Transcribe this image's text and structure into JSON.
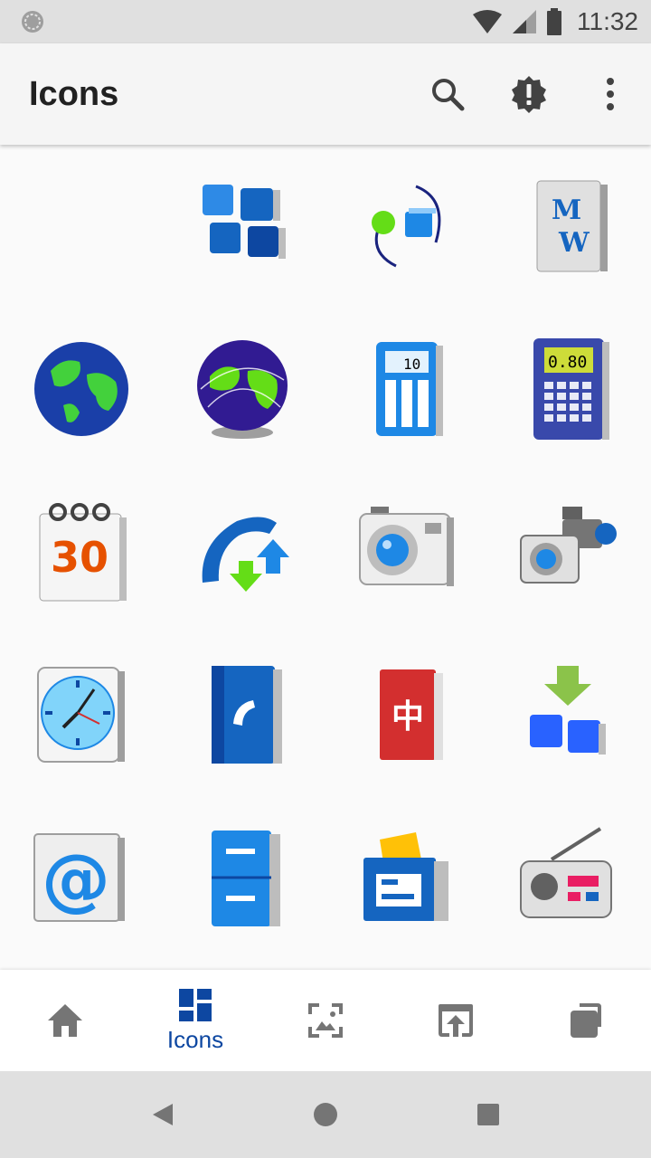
{
  "status_bar": {
    "time": "11:32"
  },
  "app_bar": {
    "title": "Icons"
  },
  "icons": [
    {
      "name": "windows-tiles-icon"
    },
    {
      "name": "network-connection-icon"
    },
    {
      "name": "mediawiki-icon"
    },
    {
      "name": "globe-icon"
    },
    {
      "name": "network-globe-icon"
    },
    {
      "name": "calculator-icon",
      "text": "10"
    },
    {
      "name": "scientific-calculator-icon",
      "text": "0.80"
    },
    {
      "name": "calendar-icon",
      "text": "30"
    },
    {
      "name": "phone-transfer-icon"
    },
    {
      "name": "photo-camera-icon"
    },
    {
      "name": "camera-video-icon"
    },
    {
      "name": "clock-icon"
    },
    {
      "name": "address-book-icon"
    },
    {
      "name": "dictionary-icon",
      "text": "中"
    },
    {
      "name": "install-package-icon"
    },
    {
      "name": "email-at-icon",
      "text": "@"
    },
    {
      "name": "file-cabinet-icon"
    },
    {
      "name": "file-manager-icon"
    },
    {
      "name": "radio-icon"
    },
    {
      "name": "multimedia-icon"
    }
  ],
  "bottom_nav": {
    "icons_label": "Icons"
  },
  "colors": {
    "accent": "#0d47a1",
    "icon_blue": "#1e6fd9",
    "appbar_bg": "#f5f5f5"
  }
}
